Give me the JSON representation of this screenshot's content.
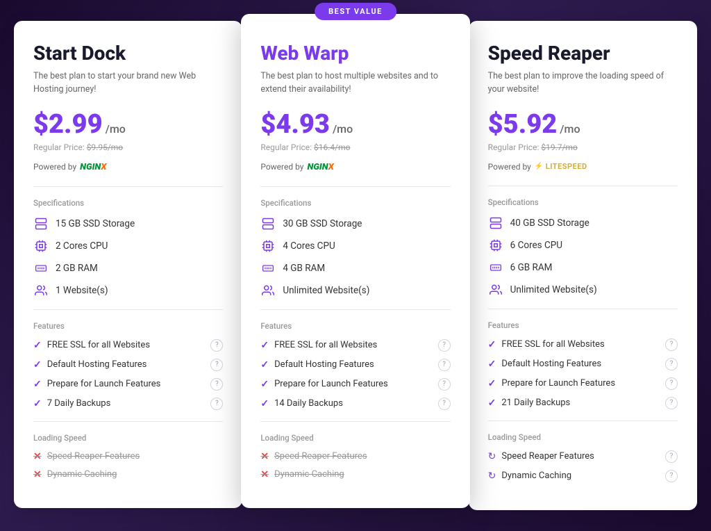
{
  "cards": [
    {
      "id": "start-dock",
      "name": "Start Dock",
      "nameClass": "normal",
      "bestValue": false,
      "desc": "The best plan to start your brand new Web Hosting journey!",
      "price": "$2.99",
      "pricePer": "/mo",
      "regularPrice": "$9.95/mo",
      "poweredBy": "NGINX",
      "poweredByType": "nginx",
      "specs": [
        {
          "icon": "storage",
          "label": "15 GB SSD Storage"
        },
        {
          "icon": "cpu",
          "label": "2 Cores CPU"
        },
        {
          "icon": "ram",
          "label": "2 GB RAM"
        },
        {
          "icon": "website",
          "label": "1 Website(s)"
        }
      ],
      "features": [
        "FREE SSL for all Websites",
        "Default Hosting Features",
        "Prepare for Launch Features",
        "7 Daily Backups"
      ],
      "speedItems": [
        {
          "label": "Speed Reaper Features",
          "active": false
        },
        {
          "label": "Dynamic Caching",
          "active": false
        }
      ]
    },
    {
      "id": "web-warp",
      "name": "Web Warp",
      "nameClass": "purple",
      "bestValue": true,
      "bestValueLabel": "BEST VALUE",
      "desc": "The best plan to host multiple websites and to extend their availability!",
      "price": "$4.93",
      "pricePer": "/mo",
      "regularPrice": "$16.4/mo",
      "poweredBy": "NGINX",
      "poweredByType": "nginx",
      "specs": [
        {
          "icon": "storage",
          "label": "30 GB SSD Storage"
        },
        {
          "icon": "cpu",
          "label": "4 Cores CPU"
        },
        {
          "icon": "ram",
          "label": "4 GB RAM"
        },
        {
          "icon": "website",
          "label": "Unlimited Website(s)"
        }
      ],
      "features": [
        "FREE SSL for all Websites",
        "Default Hosting Features",
        "Prepare for Launch Features",
        "14 Daily Backups"
      ],
      "speedItems": [
        {
          "label": "Speed Reaper Features",
          "active": false
        },
        {
          "label": "Dynamic Caching",
          "active": false
        }
      ]
    },
    {
      "id": "speed-reaper",
      "name": "Speed Reaper",
      "nameClass": "normal",
      "bestValue": false,
      "desc": "The best plan to improve the loading speed of your website!",
      "price": "$5.92",
      "pricePer": "/mo",
      "regularPrice": "$19.7/mo",
      "poweredBy": "LITESPEED",
      "poweredByType": "litespeed",
      "specs": [
        {
          "icon": "storage",
          "label": "40 GB SSD Storage"
        },
        {
          "icon": "cpu",
          "label": "6 Cores CPU"
        },
        {
          "icon": "ram",
          "label": "6 GB RAM"
        },
        {
          "icon": "website",
          "label": "Unlimited Website(s)"
        }
      ],
      "features": [
        "FREE SSL for all Websites",
        "Default Hosting Features",
        "Prepare for Launch Features",
        "21 Daily Backups"
      ],
      "speedItems": [
        {
          "label": "Speed Reaper Features",
          "active": true
        },
        {
          "label": "Dynamic Caching",
          "active": true
        }
      ]
    }
  ],
  "labels": {
    "specifications": "Specifications",
    "features": "Features",
    "loadingSpeed": "Loading Speed",
    "poweredByText": "Powered by",
    "regularPriceText": "Regular Price:"
  }
}
